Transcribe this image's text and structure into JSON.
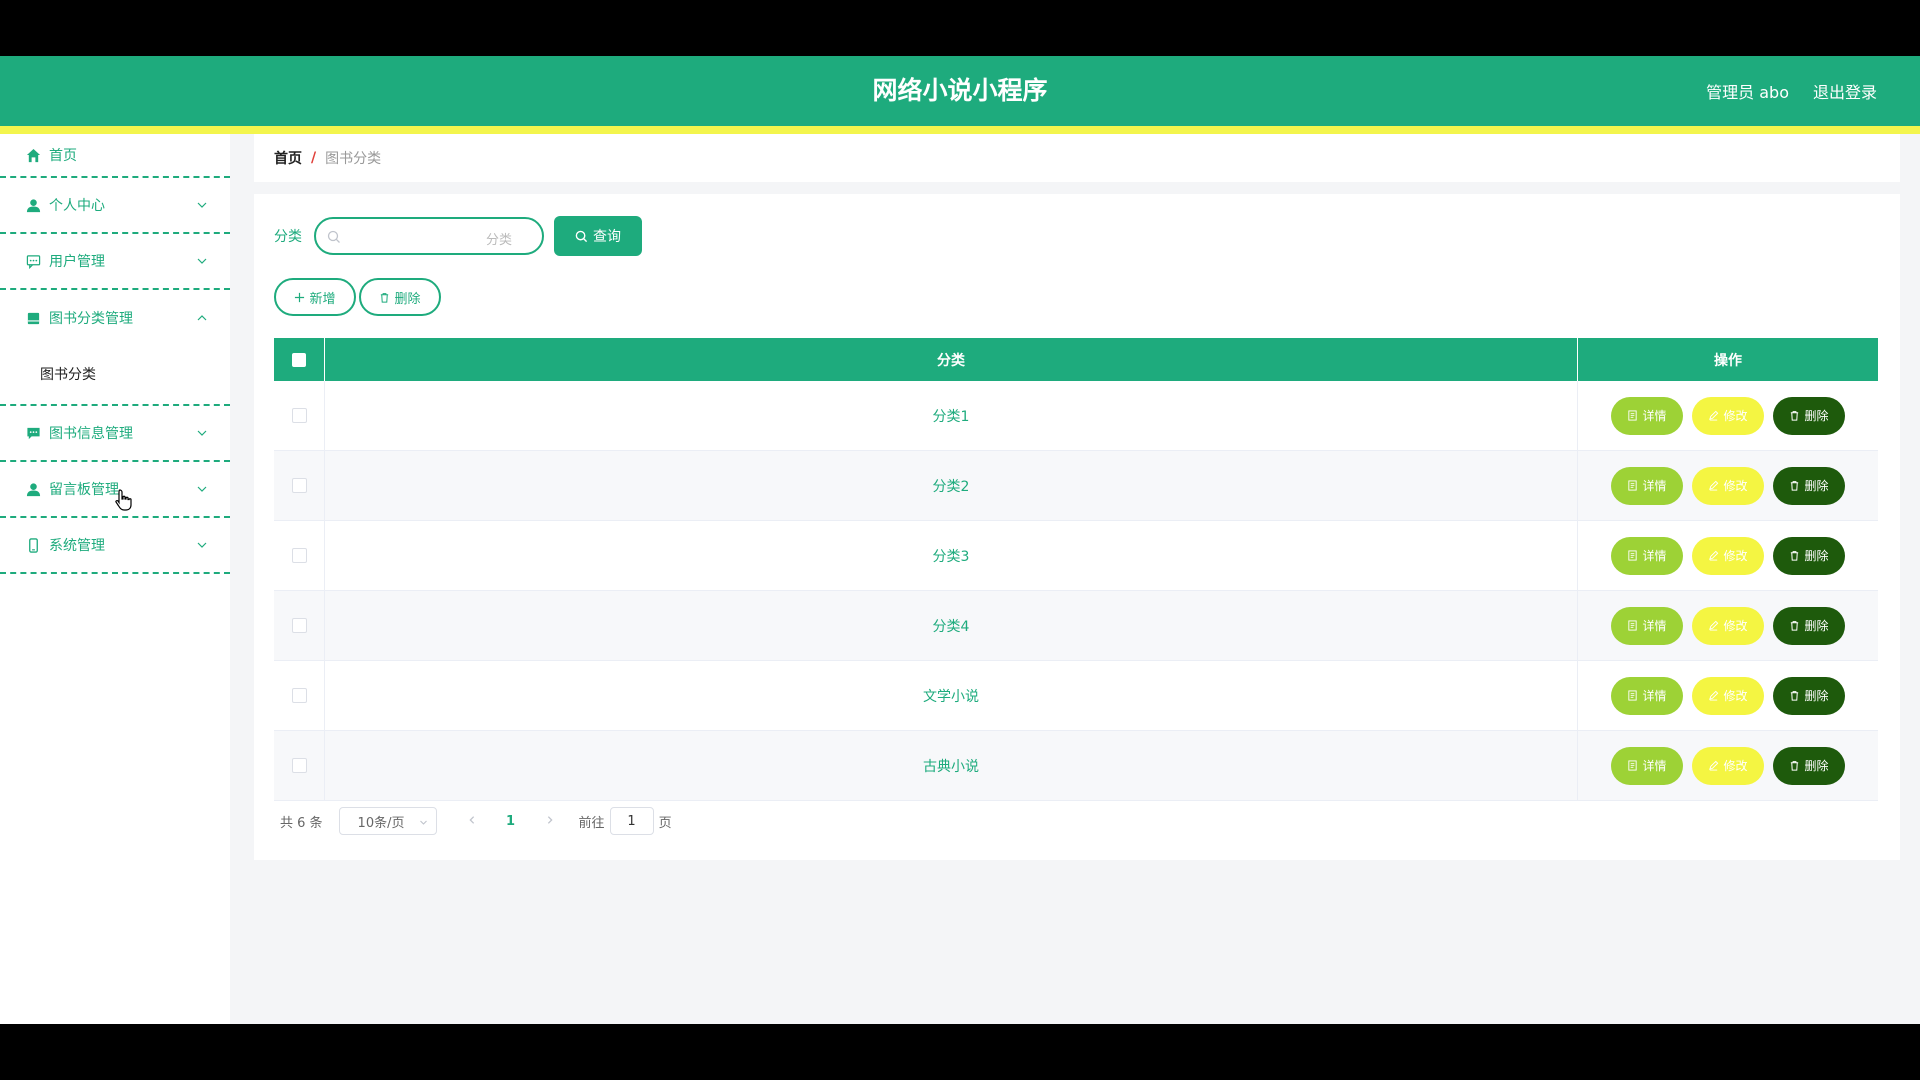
{
  "header": {
    "title": "网络小说小程序",
    "admin_label": "管理员 abo",
    "logout_label": "退出登录"
  },
  "colors": {
    "primary": "#1eab7d",
    "stripe": "#f3f54d",
    "detail_button": "#9dd236",
    "edit_button": "#f4f542",
    "delete_button": "#1e5a0c",
    "breadcrumb_separator": "#e0403a"
  },
  "sidebar": {
    "home": "首页",
    "personal": "个人中心",
    "users": "用户管理",
    "book_category_mgmt": "图书分类管理",
    "book_category_sub": "图书分类",
    "book_info_mgmt": "图书信息管理",
    "message_board": "留言板管理",
    "system": "系统管理"
  },
  "breadcrumb": {
    "home": "首页",
    "separator": "/",
    "current": "图书分类"
  },
  "filter": {
    "label": "分类",
    "placeholder": "分类",
    "value": "",
    "query_button": "查询"
  },
  "actions": {
    "add": "新增",
    "delete": "删除"
  },
  "table": {
    "columns": [
      "分类",
      "操作"
    ],
    "rows": [
      "分类1",
      "分类2",
      "分类3",
      "分类4",
      "文学小说",
      "古典小说"
    ],
    "row_actions": {
      "detail": "详情",
      "edit": "修改",
      "delete": "删除"
    }
  },
  "pagination": {
    "total": "共 6 条",
    "page_size": "10条/页",
    "current_page": "1",
    "goto_prefix": "前往",
    "goto_value": "1",
    "goto_suffix": "页"
  }
}
